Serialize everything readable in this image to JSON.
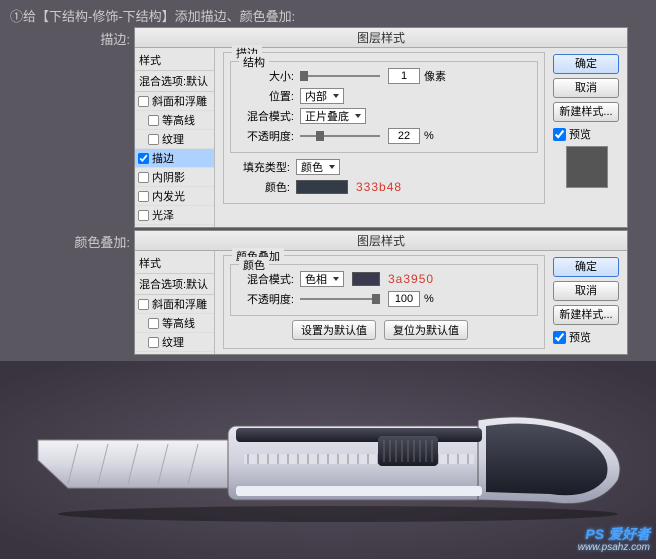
{
  "instruction": "①给【下结构-修饰-下结构】添加描边、颜色叠加:",
  "labels": {
    "stroke": "描边:",
    "overlay": "颜色叠加:"
  },
  "dialog_title": "图层样式",
  "style_list": {
    "header": "样式",
    "blend_defaults": "混合选项:默认",
    "items": {
      "bevel": "斜面和浮雕",
      "contour": "等高线",
      "texture": "纹理",
      "stroke": "描边",
      "inner_shadow": "内阴影",
      "inner_glow": "内发光",
      "satin": "光泽"
    }
  },
  "stroke_panel": {
    "outer_legend": "描边",
    "legend": "结构",
    "size_label": "大小:",
    "size_value": "1",
    "size_unit": "像素",
    "position_label": "位置:",
    "position_value": "内部",
    "blend_label": "混合模式:",
    "blend_value": "正片叠底",
    "opacity_label": "不透明度:",
    "opacity_value": "22",
    "pct": "%",
    "fill_type_label": "填充类型:",
    "fill_type_value": "颜色",
    "color_label": "颜色:",
    "color": "#333b48",
    "hex_display": "333b48"
  },
  "overlay_panel": {
    "outer_legend": "颜色叠加",
    "legend": "颜色",
    "blend_label": "混合模式:",
    "blend_value": "色相",
    "color": "#3a3950",
    "hex_display": "3a3950",
    "opacity_label": "不透明度:",
    "opacity_value": "100",
    "pct": "%",
    "reset_a": "设置为默认值",
    "reset_b": "复位为默认值"
  },
  "buttons": {
    "ok": "确定",
    "cancel": "取消",
    "new_style": "新建样式...",
    "preview": "预览"
  },
  "watermark": {
    "brand": "PS 爱好者",
    "url": "www.psahz.com"
  }
}
